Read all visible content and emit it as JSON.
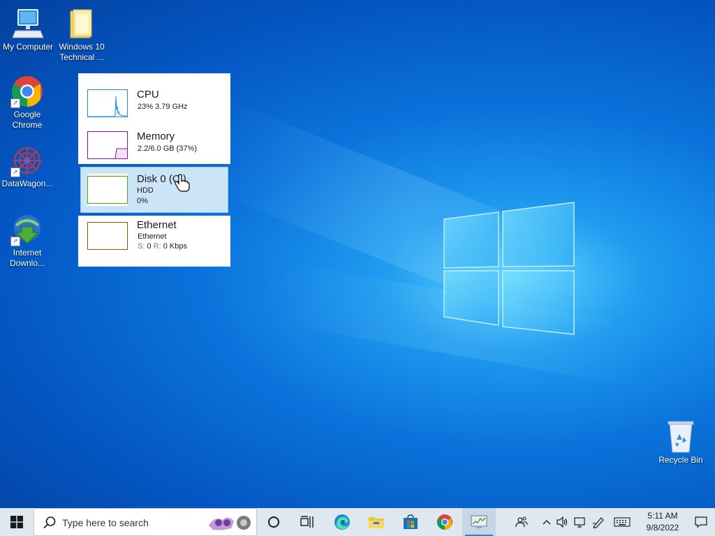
{
  "desktop": {
    "icons": [
      {
        "label": "My Computer"
      },
      {
        "label": "Windows 10 Technical ..."
      },
      {
        "label": "Google Chrome"
      },
      {
        "label": "DataWagon..."
      },
      {
        "label": "Internet Downlo..."
      },
      {
        "label": "Recycle Bin"
      }
    ]
  },
  "performance": {
    "cpu": {
      "title": "CPU",
      "detail": "23% 3.79 GHz"
    },
    "memory": {
      "title": "Memory",
      "detail": "2.2/6.0 GB (37%)"
    },
    "disk": {
      "title": "Disk 0 (C:)",
      "type": "HDD",
      "usage": "0%"
    },
    "ethernet": {
      "title": "Ethernet",
      "adapter": "Ethernet",
      "send_label": "S:",
      "send": "0",
      "recv_label": "R:",
      "recv": "0 Kbps"
    }
  },
  "taskbar": {
    "search_placeholder": "Type here to search",
    "time": "5:11 AM",
    "date": "9/8/2022"
  },
  "colors": {
    "cpu_graph": "#1f8dd6",
    "memory_graph": "#8b12ae",
    "disk_graph": "#4da60c",
    "ethernet_graph": "#a74f01"
  }
}
